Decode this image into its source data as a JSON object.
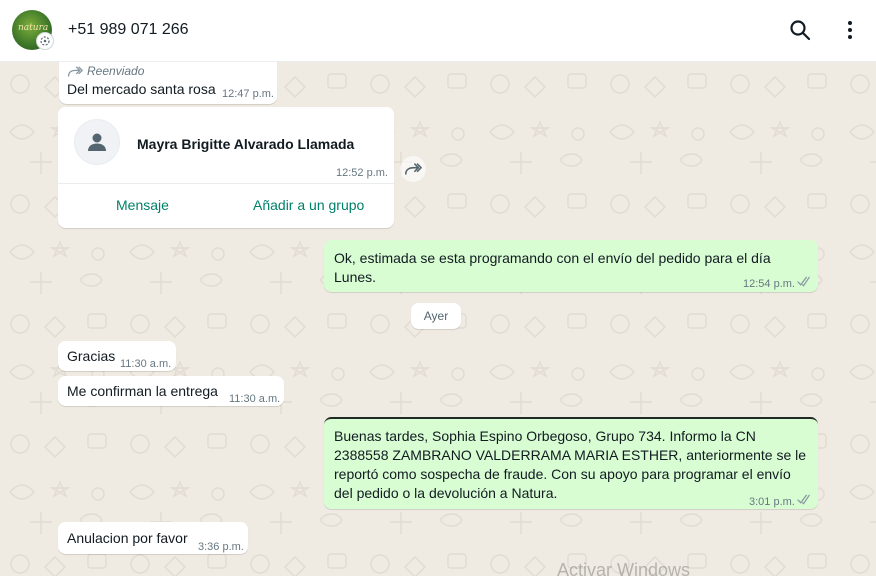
{
  "header": {
    "contact_name": "+51 989 071 266",
    "avatar_text": "natura",
    "icons": [
      "search-icon",
      "menu-dots-icon",
      "status-icon"
    ]
  },
  "messages": [
    {
      "id": "m1",
      "direction": "in",
      "forwarded_label": "Reenviado",
      "text": "Del mercado santa rosa",
      "time": "12:47 p.m."
    },
    {
      "id": "m2",
      "direction": "in",
      "type": "contact-card",
      "contact_name": "Mayra Brigitte Alvarado Llamada",
      "time": "12:52 p.m.",
      "actions": [
        "Mensaje",
        "Añadir a un grupo"
      ]
    },
    {
      "id": "m3",
      "direction": "out",
      "text": "Ok, estimada se esta programando con el envío del pedido para el día Lunes.",
      "time": "12:54 p.m.",
      "status": "read"
    },
    {
      "id": "m4",
      "direction": "in",
      "text": "Gracias",
      "time": "11:30 a.m."
    },
    {
      "id": "m5",
      "direction": "in",
      "text": "Me confirman la entrega",
      "time": "11:30 a.m."
    },
    {
      "id": "m6",
      "direction": "out",
      "text": "Buenas tardes, Sophia Espino Orbegoso, Grupo 734. Informo la CN 2388558 ZAMBRANO VALDERRAMA MARIA ESTHER, anteriormente se le reportó como sospecha de fraude. Con su apoyo para programar el envío del pedido o la devolución a Natura.",
      "time": "3:01 p.m.",
      "status": "read"
    },
    {
      "id": "m7",
      "direction": "in",
      "text": "Anulacion por favor",
      "time": "3:36 p.m."
    }
  ],
  "date_separator": "Ayer",
  "watermark": "Activar Windows",
  "colors": {
    "background": "#efeae2",
    "incoming_bubble": "#ffffff",
    "outgoing_bubble": "#d9fdd3",
    "accent": "#008069",
    "read_ticks": "#8696a0"
  }
}
